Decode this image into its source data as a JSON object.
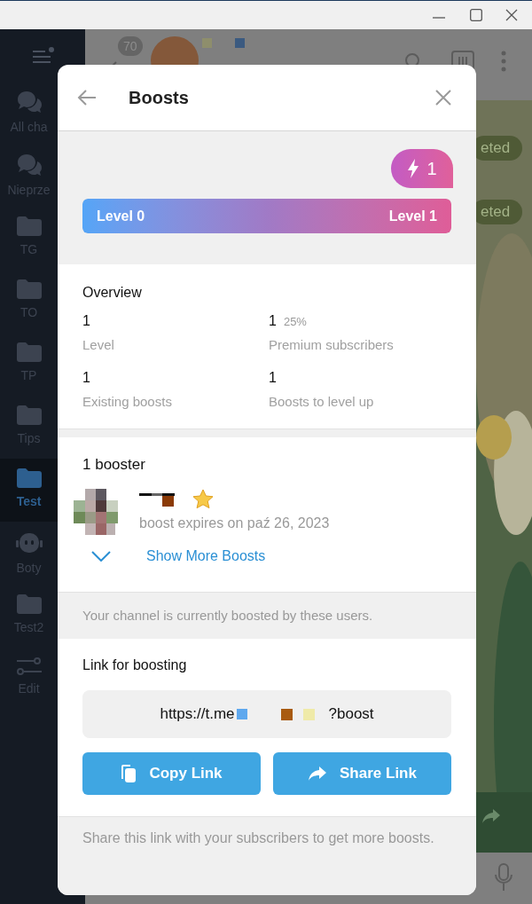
{
  "sidebar": {
    "items": [
      {
        "label": "All cha",
        "kind": "chats",
        "selected": false
      },
      {
        "label": "Nieprze",
        "kind": "chats",
        "selected": false
      },
      {
        "label": "TG",
        "kind": "folder",
        "selected": false
      },
      {
        "label": "TO",
        "kind": "folder",
        "selected": false
      },
      {
        "label": "TP",
        "kind": "folder",
        "selected": false
      },
      {
        "label": "Tips",
        "kind": "folder",
        "selected": false
      },
      {
        "label": "Test",
        "kind": "folder",
        "selected": true
      },
      {
        "label": "Boty",
        "kind": "bot",
        "selected": false
      },
      {
        "label": "Test2",
        "kind": "folder",
        "selected": false
      },
      {
        "label": "Edit",
        "kind": "edit",
        "selected": false
      }
    ]
  },
  "chat_header": {
    "unread_count": "70"
  },
  "chat_messages": [
    {
      "status": "eted"
    },
    {
      "status": "eted"
    }
  ],
  "dialog": {
    "title": "Boosts",
    "boost_badge": "1",
    "level_bar": {
      "current": "Level 0",
      "next": "Level 1",
      "level": 1
    },
    "overview": {
      "title": "Overview",
      "stats": [
        {
          "value": "1",
          "label": "Level"
        },
        {
          "value": "1",
          "extra": "25%",
          "label": "Premium subscribers"
        },
        {
          "value": "1",
          "label": "Existing boosts"
        },
        {
          "value": "1",
          "label": "Boosts to level up"
        }
      ]
    },
    "boosters": {
      "title": "1 booster",
      "items": [
        {
          "premium": true,
          "expiry": "boost expires on paź 26, 2023"
        }
      ],
      "show_more": "Show More Boosts"
    },
    "boosters_note": "Your channel is currently boosted by these users.",
    "link": {
      "title": "Link for boosting",
      "prefix": "https://t.me",
      "suffix": "?boost"
    },
    "buttons": [
      {
        "kind": "copy",
        "label": "Copy Link"
      },
      {
        "kind": "share",
        "label": "Share Link"
      }
    ],
    "link_note": "Share this link with your subscribers to get more boosts."
  }
}
